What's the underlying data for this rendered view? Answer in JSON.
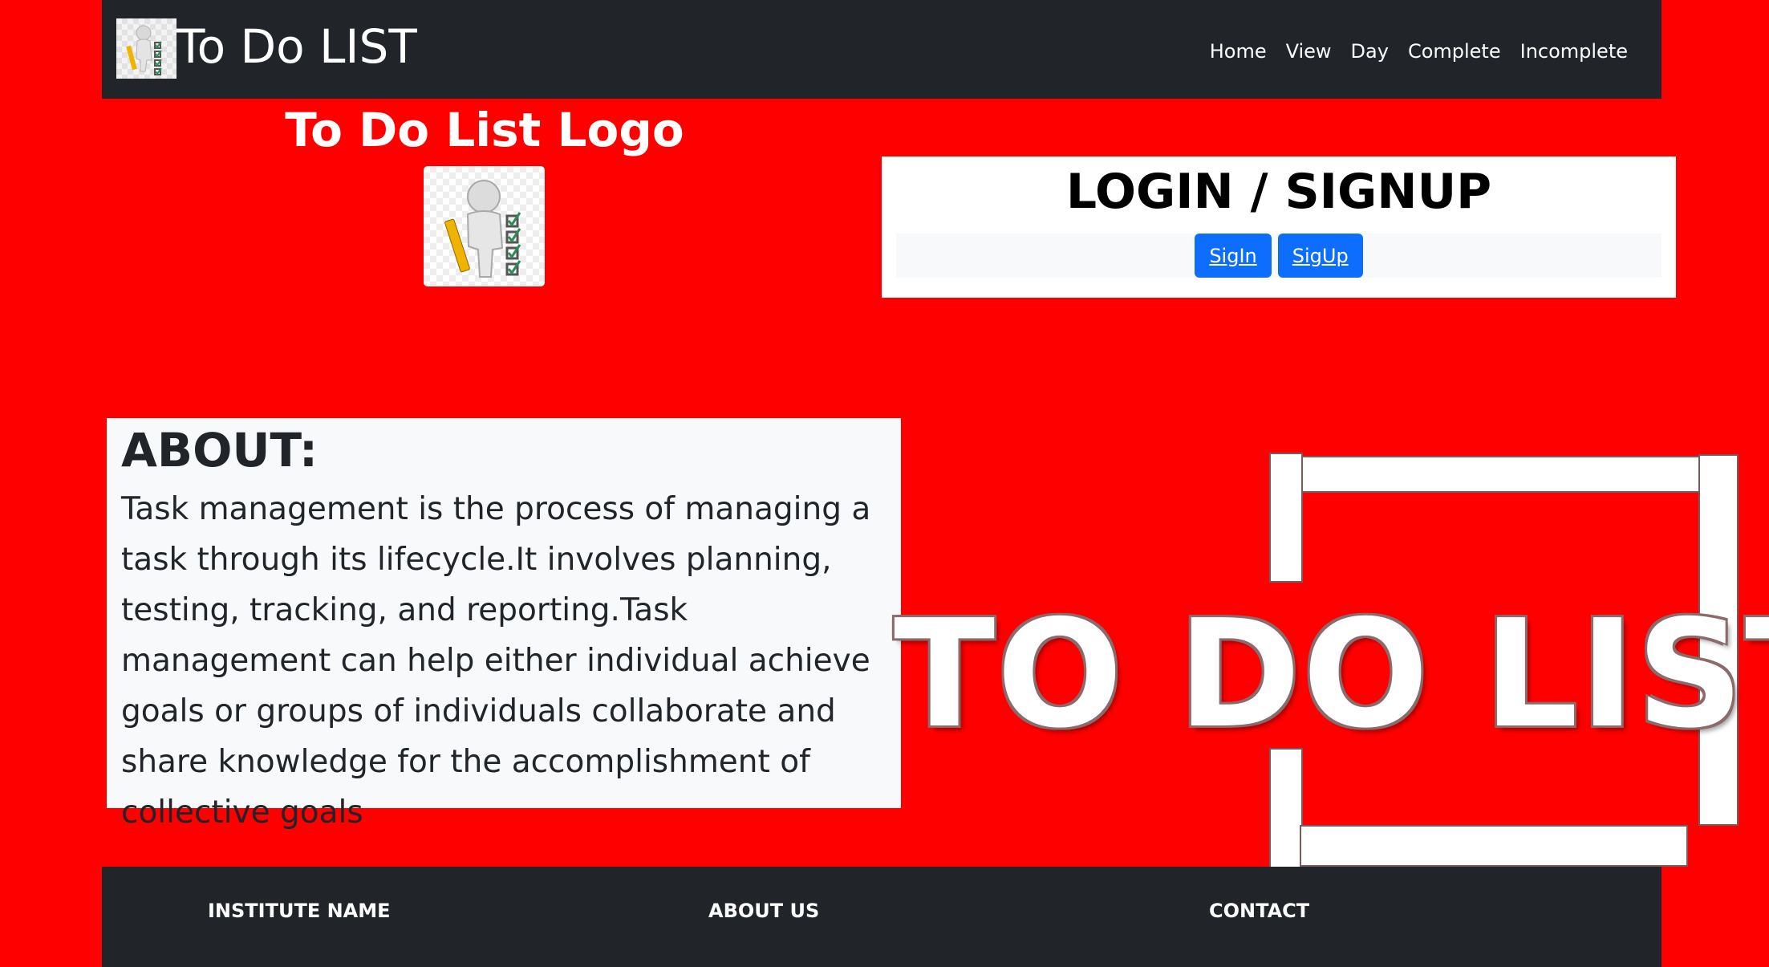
{
  "navbar": {
    "title": "To Do LIST",
    "links": [
      "Home",
      "View",
      "Day",
      "Complete",
      "Incomplete"
    ]
  },
  "logo_section": {
    "heading": "To Do List Logo"
  },
  "login": {
    "heading": "LOGIN / SIGNUP",
    "signin_label": "SigIn",
    "signup_label": "SigUp"
  },
  "about": {
    "heading": "ABOUT:",
    "text": "Task management is the process of managing a task through its lifecycle.It involves planning, testing, tracking, and reporting.Task management can help either individual achieve goals or groups of individuals collaborate and share knowledge for the accomplishment of collective goals"
  },
  "graphic": {
    "text": "TO DO LIST"
  },
  "footer": {
    "col1": "INSTITUTE NAME",
    "col2": "ABOUT US",
    "col3": "CONTACT"
  },
  "colors": {
    "page_background": "#ff0000",
    "navbar_background": "#212529",
    "button_primary": "#0d6efd"
  },
  "icons": [
    "todo-figure-icon"
  ]
}
